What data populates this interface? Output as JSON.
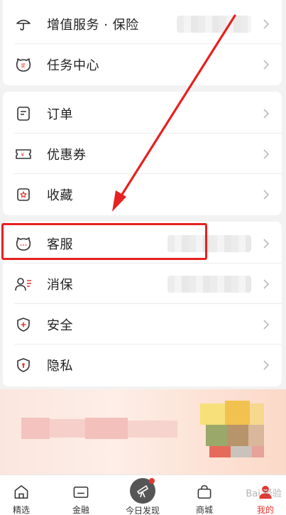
{
  "groups": [
    {
      "items": [
        {
          "label": "增值服务 · 保险",
          "icon": "umbrella-icon"
        },
        {
          "label": "任务中心",
          "icon": "cat-badge-icon"
        }
      ]
    },
    {
      "items": [
        {
          "label": "订单",
          "icon": "order-icon"
        },
        {
          "label": "优惠券",
          "icon": "coupon-icon"
        },
        {
          "label": "收藏",
          "icon": "star-box-icon"
        }
      ]
    },
    {
      "items": [
        {
          "label": "客服",
          "icon": "cat-chat-icon"
        },
        {
          "label": "消保",
          "icon": "person-list-icon"
        },
        {
          "label": "安全",
          "icon": "shield-plus-icon"
        },
        {
          "label": "隐私",
          "icon": "shield-lock-icon"
        }
      ]
    }
  ],
  "tabbar": {
    "tabs": [
      {
        "label": "精选",
        "icon": "home-icon"
      },
      {
        "label": "金融",
        "icon": "card-icon"
      },
      {
        "label": "今日发现",
        "icon": "telescope-icon"
      },
      {
        "label": "商城",
        "icon": "shop-bag-icon"
      },
      {
        "label": "我的",
        "icon": "profile-icon"
      }
    ]
  },
  "watermark": "Bai 经验",
  "colors": {
    "accent": "#e8342e",
    "highlight": "#e82020",
    "text": "#222222"
  }
}
